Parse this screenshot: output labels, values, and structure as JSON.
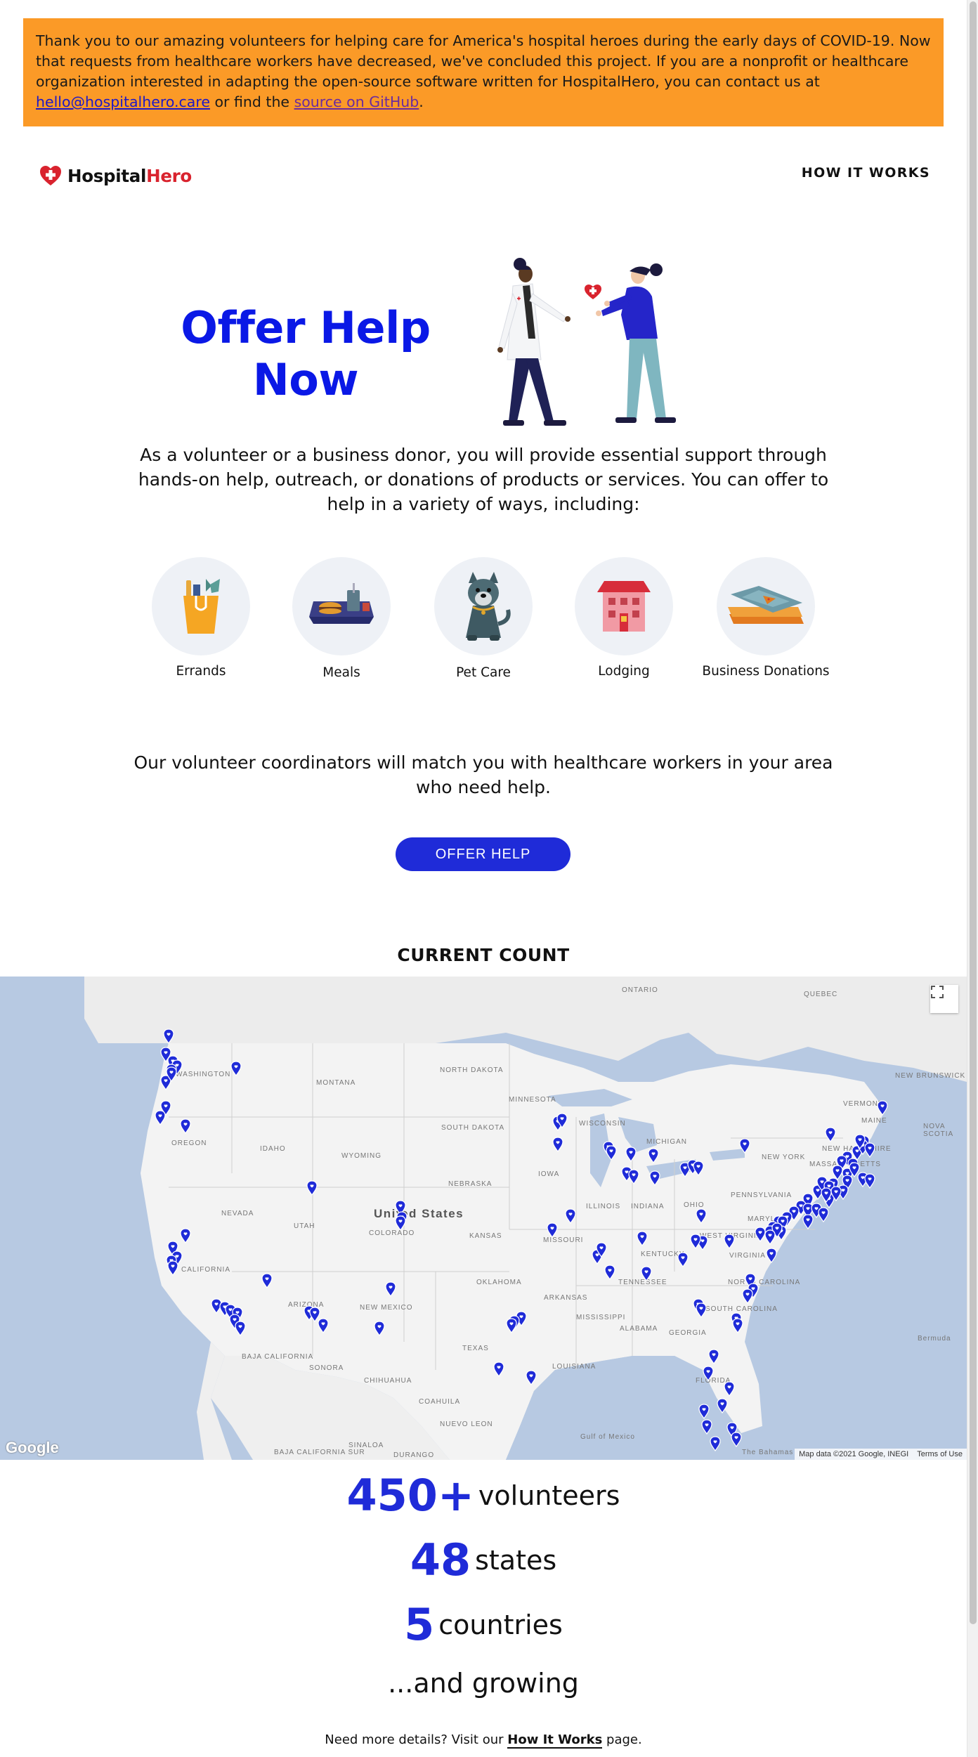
{
  "banner": {
    "text_before": "Thank you to our amazing volunteers for helping care for America's hospital heroes during the early days of COVID-19. Now that requests from healthcare workers have decreased, we've concluded this project. If you are a nonprofit or healthcare organization interested in adapting the open-source software written for HospitalHero, you can contact us at ",
    "email": "hello@hospitalhero.care",
    "text_middle": " or find the ",
    "github_link": "source on GitHub",
    "text_after": "."
  },
  "header": {
    "logo_part1": "Hospital",
    "logo_part2": "Hero",
    "nav_how_it_works": "HOW IT WORKS"
  },
  "hero": {
    "title": "Offer Help Now"
  },
  "intro": "As a volunteer or a business donor, you will provide essential support through hands-on help, outreach, or donations of products or services. You can offer to help in a variety of ways, including:",
  "categories": [
    {
      "label": "Errands",
      "icon": "grocery-bag-icon"
    },
    {
      "label": "Meals",
      "icon": "meal-tray-icon"
    },
    {
      "label": "Pet Care",
      "icon": "dog-icon"
    },
    {
      "label": "Lodging",
      "icon": "house-icon"
    },
    {
      "label": "Business Donations",
      "icon": "donation-boxes-icon"
    }
  ],
  "coordinators": "Our volunteer coordinators will match you with healthcare workers in your area who need help.",
  "offer_button": "OFFER HELP",
  "current_count_title": "CURRENT COUNT",
  "map": {
    "country_label": "United States",
    "labels": [
      "ONTARIO",
      "QUEBEC",
      "WASHINGTON",
      "MONTANA",
      "NORTH DAKOTA",
      "MINNESOTA",
      "OREGON",
      "IDAHO",
      "SOUTH DAKOTA",
      "WISCONSIN",
      "MICHIGAN",
      "WYOMING",
      "IOWA",
      "NEW YORK",
      "NEBRASKA",
      "NEVADA",
      "UTAH",
      "COLORADO",
      "ILLINOIS",
      "INDIANA",
      "OHIO",
      "PENNSYLVANIA",
      "KANSAS",
      "MISSOURI",
      "CALIFORNIA",
      "KENTUCKY",
      "WEST VIRGINIA",
      "VIRGINIA",
      "OKLAHOMA",
      "TENNESSEE",
      "NORTH CAROLINA",
      "ARIZONA",
      "NEW MEXICO",
      "ARKANSAS",
      "SOUTH CAROLINA",
      "MISSISSIPPI",
      "ALABAMA",
      "GEORGIA",
      "TEXAS",
      "LOUISIANA",
      "FLORIDA",
      "BAJA CALIFORNIA",
      "SONORA",
      "CHIHUAHUA",
      "COAHUILA",
      "NUEVO LEON",
      "SINALOA",
      "DURANGO",
      "VERMONT",
      "MAINE",
      "NEW HAMPSHIRE",
      "MASSACHUSETTS",
      "NEW BRUNSWICK",
      "NOVA SCOTIA",
      "MARYLAND",
      "Bermuda",
      "The Bahamas",
      "Gulf of Mexico",
      "BAJA CALIFORNIA SUR"
    ],
    "attribution": "Map data ©2021 Google, INEGI",
    "terms": "Terms of Use",
    "google": "Google"
  },
  "stats": [
    {
      "number": "450+",
      "word": "volunteers"
    },
    {
      "number": "48",
      "word": "states"
    },
    {
      "number": "5",
      "word": "countries"
    }
  ],
  "growing": "...and growing",
  "details": {
    "before": "Need more details? Visit our ",
    "link": "How It Works",
    "after": " page."
  },
  "colors": {
    "brand_blue": "#1f2bd8",
    "hero_title_blue": "#0a18e6",
    "banner_orange": "#fb9a27",
    "logo_red": "#d9232e"
  }
}
